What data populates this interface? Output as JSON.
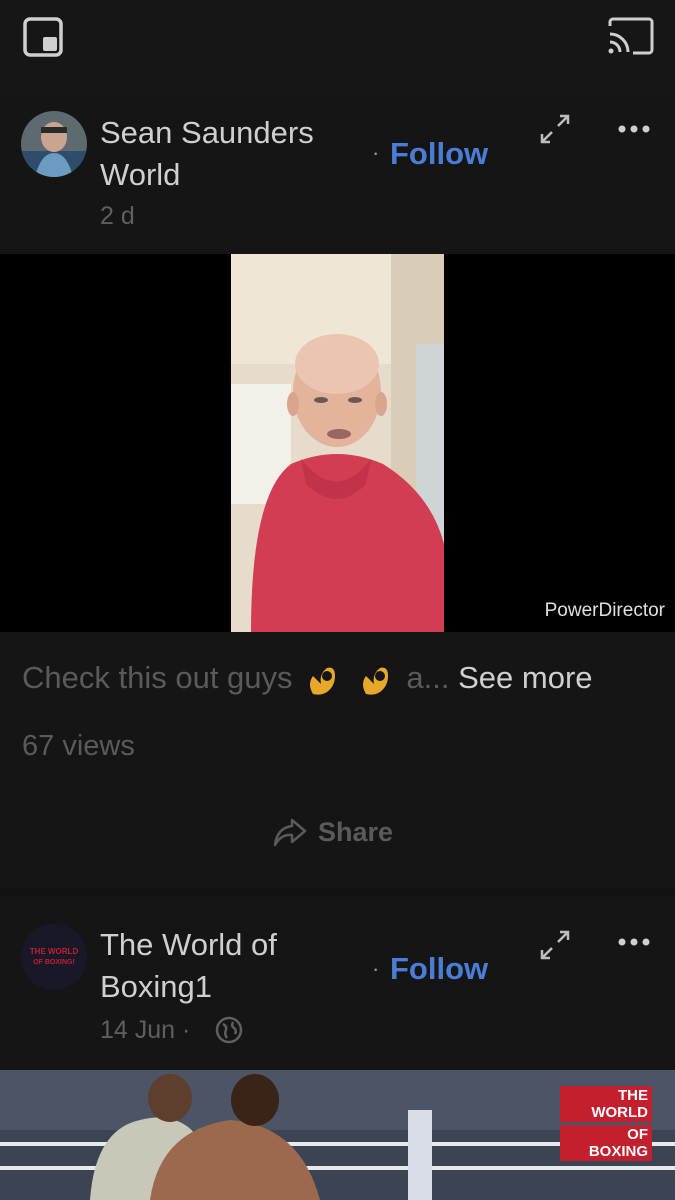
{
  "post1": {
    "author_line1": "Sean Saunders",
    "author_line2": "World",
    "dot": "·",
    "follow": "Follow",
    "time": "2 d",
    "watermark": "PowerDirector",
    "caption_start": "Check this out guys",
    "caption_end": "a...",
    "see_more": "See more",
    "views": "67 views",
    "share": "Share"
  },
  "post2": {
    "author_line1": "The World of",
    "author_line2": "Boxing1",
    "dot": "·",
    "follow": "Follow",
    "time": "14 Jun",
    "time_dot": "·",
    "avatar_logo": "THE WORLD OF BOXING!",
    "badge_line1": "THE WORLD",
    "badge_line2": "OF BOXING"
  },
  "icons": {
    "top_left": "picture-in-picture-icon",
    "top_right": "cast-icon",
    "expand": "expand-icon",
    "more": "more-icon",
    "share": "share-arrow-icon",
    "globe": "globe-icon",
    "caption_emoji": "ok-hand-emoji"
  },
  "colors": {
    "follow": "#4a7ed6",
    "background": "#121212",
    "badge": "#c31f2f"
  }
}
